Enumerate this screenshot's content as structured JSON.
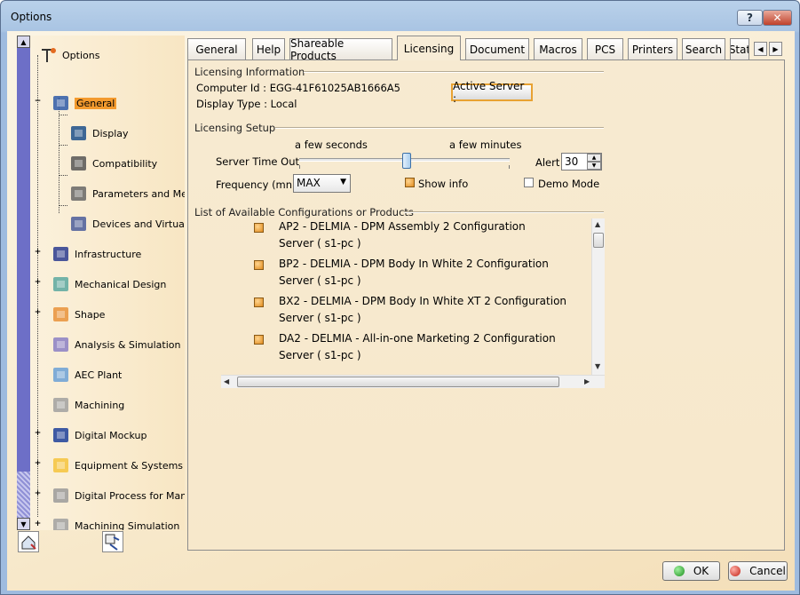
{
  "window": {
    "title": "Options"
  },
  "titlebar": {
    "help_label": "?",
    "close_label": "✕"
  },
  "tree": {
    "root_label": "Options",
    "items": [
      {
        "label": "General",
        "icon": "general-icon",
        "selected": true
      },
      {
        "label": "Display",
        "icon": "display-icon"
      },
      {
        "label": "Compatibility",
        "icon": "compatibility-icon"
      },
      {
        "label": "Parameters and Measu",
        "icon": "parameters-icon"
      },
      {
        "label": "Devices and Virtual Re",
        "icon": "devices-icon"
      },
      {
        "label": "Infrastructure",
        "icon": "infrastructure-icon"
      },
      {
        "label": "Mechanical Design",
        "icon": "mechanical-design-icon"
      },
      {
        "label": "Shape",
        "icon": "shape-icon"
      },
      {
        "label": "Analysis & Simulation",
        "icon": "analysis-icon"
      },
      {
        "label": "AEC Plant",
        "icon": "aec-plant-icon"
      },
      {
        "label": "Machining",
        "icon": "machining-icon"
      },
      {
        "label": "Digital Mockup",
        "icon": "digital-mockup-icon"
      },
      {
        "label": "Equipment & Systems",
        "icon": "equipment-icon"
      },
      {
        "label": "Digital Process for Manuf",
        "icon": "digital-process-icon"
      },
      {
        "label": "Machining Simulation",
        "icon": "machining-simulation-icon"
      }
    ]
  },
  "tabs": [
    {
      "label": "General"
    },
    {
      "label": "Help"
    },
    {
      "label": "Shareable Products"
    },
    {
      "label": "Licensing",
      "active": true
    },
    {
      "label": "Document"
    },
    {
      "label": "Macros"
    },
    {
      "label": "PCS"
    },
    {
      "label": "Printers"
    },
    {
      "label": "Search"
    },
    {
      "label": "Stat"
    }
  ],
  "licensing_info": {
    "title": "Licensing Information",
    "computer_id": "Computer Id : EGG-41F61025AB1666A5",
    "display_type": "Display Type : Local",
    "active_server_label": "Active Server :"
  },
  "licensing_setup": {
    "title": "Licensing Setup",
    "few_seconds": "a few seconds",
    "few_minutes": "a few minutes",
    "server_timeout_label": "Server Time Out",
    "slider_position": 0.51,
    "alert_label": "Alert",
    "alert_value": "30",
    "frequency_label": "Frequency (mn)",
    "frequency_value": "MAX",
    "show_info_label": "Show info",
    "show_info_checked": true,
    "demo_mode_label": "Demo Mode",
    "demo_mode_checked": false
  },
  "config_list": {
    "title": "List of Available Configurations or Products",
    "items": [
      {
        "name": "AP2 - DELMIA - DPM Assembly 2 Configuration",
        "server": "Server ( s1-pc )"
      },
      {
        "name": "BP2 - DELMIA - DPM Body In White 2 Configuration",
        "server": "Server ( s1-pc )"
      },
      {
        "name": "BX2 - DELMIA - DPM Body In White XT 2 Configuration",
        "server": "Server ( s1-pc )"
      },
      {
        "name": "DA2 - DELMIA - All-in-one Marketing 2 Configuration",
        "server": "Server ( s1-pc )"
      }
    ]
  },
  "buttons": {
    "ok_label": "OK",
    "cancel_label": "Cancel"
  },
  "colors": {
    "accent": "#f39a2e",
    "panel_bg": "#f7ead1",
    "tree_strip": "#6d6fc7"
  }
}
